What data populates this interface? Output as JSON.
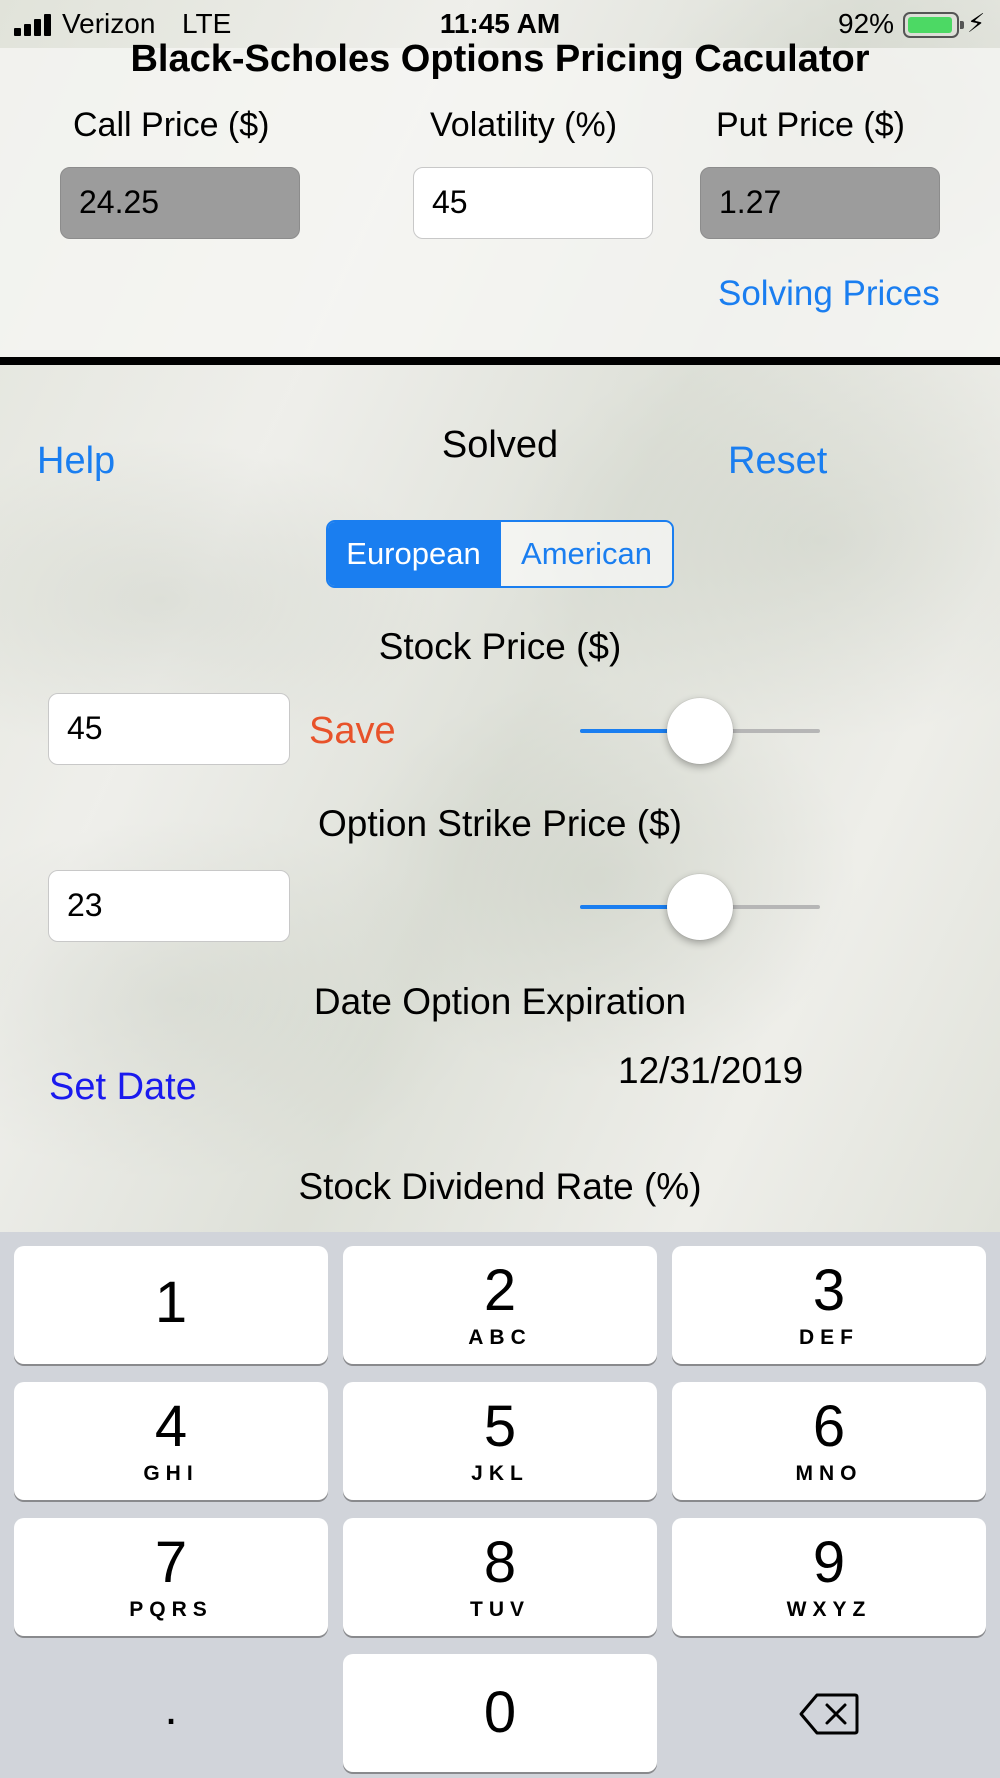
{
  "status_bar": {
    "carrier": "Verizon",
    "network": "LTE",
    "time": "11:45 AM",
    "battery_percent": "92%",
    "battery_level": 0.92
  },
  "title": "Black-Scholes Options Pricing Caculator",
  "prices": {
    "call_label": "Call Price ($)",
    "call_value": "24.25",
    "volatility_label": "Volatility (%)",
    "volatility_value": "45",
    "put_label": "Put Price ($)",
    "put_value": "1.27",
    "solving_link": "Solving Prices"
  },
  "controls": {
    "help": "Help",
    "status": "Solved",
    "reset": "Reset"
  },
  "option_type": {
    "options": [
      "European",
      "American"
    ],
    "selected": "European"
  },
  "stock": {
    "label": "Stock Price ($)",
    "value": "45",
    "save": "Save",
    "slider_level": 0.5
  },
  "strike": {
    "label": "Option Strike Price ($)",
    "value": "23",
    "slider_level": 0.5
  },
  "expiration": {
    "label": "Date Option Expiration",
    "set_date": "Set Date",
    "date": "12/31/2019"
  },
  "dividend": {
    "label": "Stock Dividend Rate (%)"
  },
  "keypad": {
    "keys": [
      {
        "digit": "1",
        "letters": ""
      },
      {
        "digit": "2",
        "letters": "ABC"
      },
      {
        "digit": "3",
        "letters": "DEF"
      },
      {
        "digit": "4",
        "letters": "GHI"
      },
      {
        "digit": "5",
        "letters": "JKL"
      },
      {
        "digit": "6",
        "letters": "MNO"
      },
      {
        "digit": "7",
        "letters": "PQRS"
      },
      {
        "digit": "8",
        "letters": "TUV"
      },
      {
        "digit": "9",
        "letters": "WXYZ"
      }
    ],
    "decimal": ".",
    "zero": "0",
    "delete_icon": "backspace-icon"
  },
  "colors": {
    "accent": "#1a7ef0",
    "save": "#e8522a",
    "set_date": "#1a1aee"
  }
}
